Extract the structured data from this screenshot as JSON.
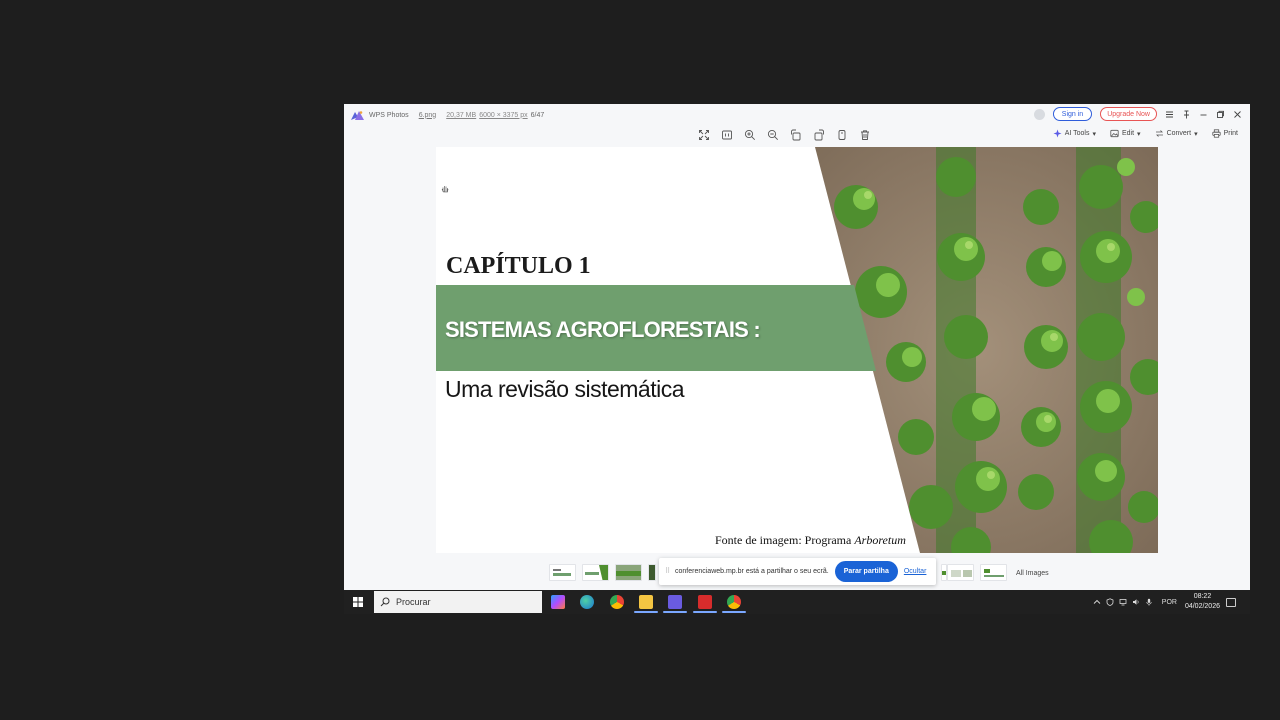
{
  "window": {
    "app_name": "WPS Photos",
    "file_name": "6.png",
    "file_size": "20,37 MB",
    "dimensions": "6000 × 3375 px",
    "position": "6/47",
    "sign_in": "Sign in",
    "upgrade": "Upgrade Now"
  },
  "toolbar": {
    "ai_tools": "AI Tools",
    "edit": "Edit",
    "convert": "Convert",
    "print": "Print"
  },
  "slide": {
    "title": "CAPÍTULO 1",
    "heading": "SISTEMAS AGROFLORESTAIS :",
    "subtitle": "Uma revisão sistemática",
    "source_prefix": "Fonte de imagem: Programa",
    "source_italic": "Arboretum",
    "band_color": "#6f9f6e"
  },
  "filmstrip": {
    "all_images": "All Images"
  },
  "sharebar": {
    "message": "conferenciaweb.mp.br está a partilhar o seu ecrã.",
    "stop": "Parar partilha",
    "hide": "Ocultar"
  },
  "taskbar": {
    "search_placeholder": "Procurar",
    "language": "POR",
    "time": "08:22",
    "date": "04/02/2026"
  },
  "colors": {
    "accent": "#2f5ddb",
    "upgrade": "#e85454",
    "share_button": "#1a63d6"
  }
}
